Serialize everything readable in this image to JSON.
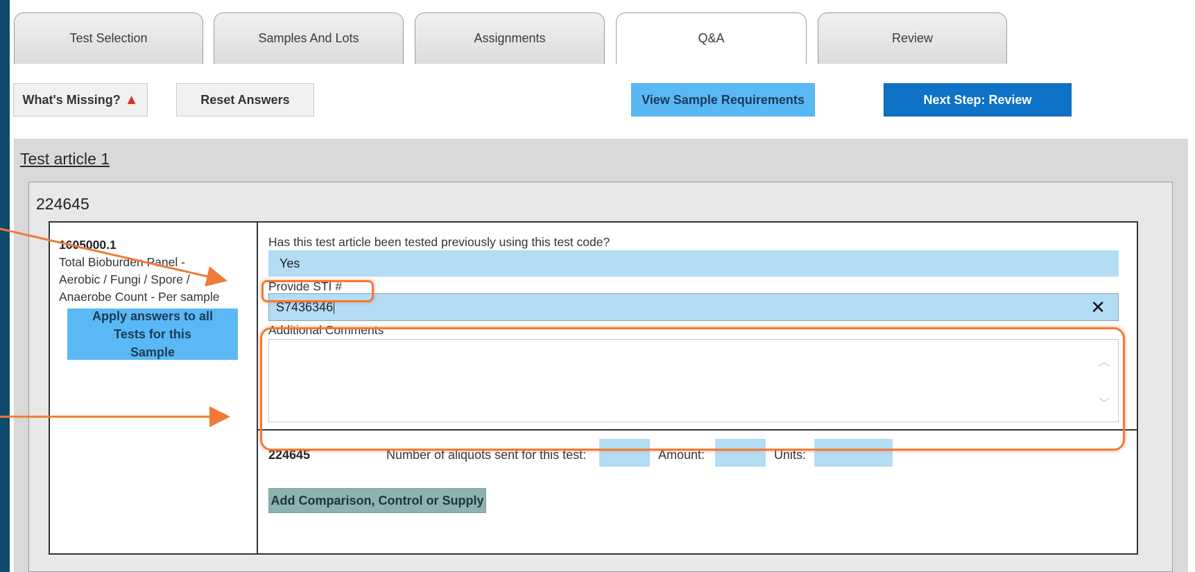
{
  "tabs": [
    {
      "label": "Test Selection",
      "active": false
    },
    {
      "label": "Samples And Lots",
      "active": false
    },
    {
      "label": "Assignments",
      "active": false
    },
    {
      "label": "Q&A",
      "active": true
    },
    {
      "label": "Review",
      "active": false
    }
  ],
  "toolbar": {
    "whats_missing": "What's Missing?",
    "reset_answers": "Reset Answers",
    "view_requirements": "View Sample Requirements",
    "next_step": "Next Step: Review"
  },
  "article": {
    "title": "Test article 1",
    "sample_id": "224645",
    "test": {
      "code": "1605000.1",
      "description": "Total Bioburden Panel - Aerobic / Fungi / Spore / Anaerobe Count - Per sample",
      "apply_button": "Apply answers to all Tests for this Sample"
    },
    "questions": {
      "q1_label": "Has this test article been tested previously using this test code?",
      "q1_answer": "Yes",
      "q2_label": "Provide STI #",
      "q2_value": "S7436346",
      "q3_label": "Additional Comments",
      "q3_value": ""
    },
    "aliquots": {
      "sample_id": "224645",
      "count_label": "Number of aliquots sent for this test:",
      "amount_label": "Amount:",
      "units_label": "Units:",
      "count_value": "",
      "amount_value": "",
      "units_value": ""
    },
    "add_button": "Add Comparison, Control or Supply"
  },
  "colors": {
    "background": "#0d4a6b",
    "accent_light": "#5ab9f5",
    "accent_dark": "#0e72c6",
    "field_fill": "#b3dcf5",
    "annotation": "#ef7a35"
  }
}
